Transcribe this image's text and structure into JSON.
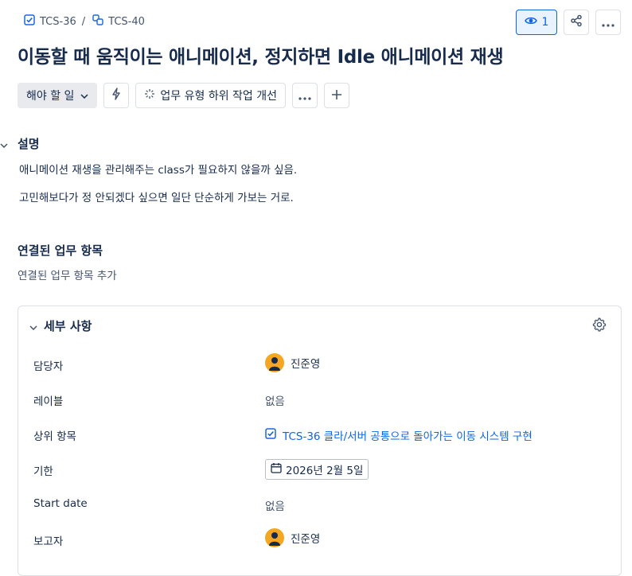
{
  "breadcrumb": {
    "parent_key": "TCS-36",
    "separator": "/",
    "current_key": "TCS-40"
  },
  "watch": {
    "count": "1"
  },
  "issue": {
    "title": "이동할 때 움직이는 애니메이션, 정지하면 Idle 애니메이션 재생"
  },
  "toolbar": {
    "status_label": "해야 할 일",
    "improve_label": "업무 유형 하위 작업 개선"
  },
  "description": {
    "heading": "설명",
    "paragraphs": [
      "애니메이션 재생을 관리해주는 class가 필요하지 않을까 싶음.",
      "고민해보다가 정 안되겠다 싶으면 일단 단순하게 가보는 거로."
    ]
  },
  "linked": {
    "heading": "연결된 업무 항목",
    "add_label": "연결된 업무 항목 추가"
  },
  "details": {
    "heading": "세부 사항",
    "fields": {
      "assignee_label": "담당자",
      "assignee_value": "진준영",
      "labels_label": "레이블",
      "labels_value": "없음",
      "parent_label": "상위 항목",
      "parent_value": "TCS-36 클라/서버 공통으로 돌아가는 이동 시스템 구현",
      "due_label": "기한",
      "due_value": "2026년 2월 5일",
      "start_label": "Start date",
      "start_value": "없음",
      "reporter_label": "보고자",
      "reporter_value": "진준영"
    }
  },
  "colors": {
    "accent": "#0c66e4",
    "avatar": "#f5a623",
    "text": "#172b4d",
    "muted": "#44546f"
  }
}
